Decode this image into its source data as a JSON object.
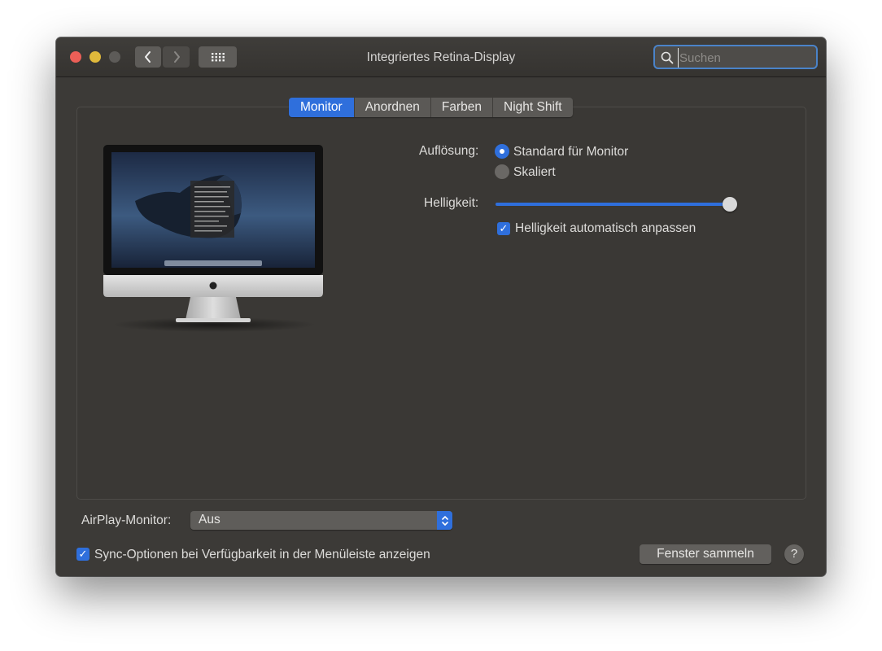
{
  "window": {
    "title": "Integriertes Retina-Display"
  },
  "search": {
    "placeholder": "Suchen",
    "value": ""
  },
  "icons": {
    "back": "chevron-left-icon",
    "forward": "chevron-right-icon",
    "grid": "grid-icon",
    "search": "magnifier-icon",
    "help": "question-mark-icon"
  },
  "tabs": [
    {
      "label": "Monitor",
      "active": true
    },
    {
      "label": "Anordnen",
      "active": false
    },
    {
      "label": "Farben",
      "active": false
    },
    {
      "label": "Night Shift",
      "active": false
    }
  ],
  "resolution": {
    "label": "Auflösung:",
    "options": [
      {
        "label": "Standard für Monitor",
        "selected": true
      },
      {
        "label": "Skaliert",
        "selected": false
      }
    ]
  },
  "brightness": {
    "label": "Helligkeit:",
    "level": 1.0,
    "auto_label": "Helligkeit automatisch anpassen",
    "auto_checked": true
  },
  "airplay": {
    "label": "AirPlay-Monitor:",
    "value": "Aus"
  },
  "sync": {
    "label": "Sync-Optionen bei Verfügbarkeit in der Menüleiste anzeigen",
    "checked": true
  },
  "buttons": {
    "gather": "Fenster sammeln",
    "help": "?"
  },
  "colors": {
    "accent": "#2f6fdc",
    "window_bg": "#3c3a37",
    "close": "#ec5f57",
    "minimize": "#e0b93b"
  }
}
